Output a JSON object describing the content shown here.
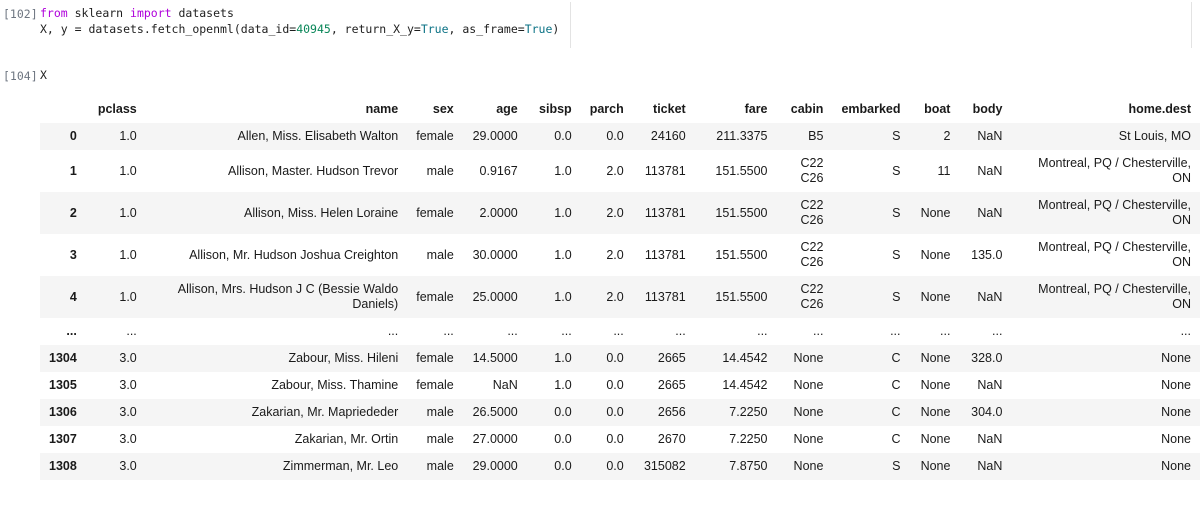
{
  "colors": {
    "keyword": "#af00db",
    "number": "#098658",
    "constant": "#0b7285",
    "code_text": "#1e1e1e",
    "exec_label": "#6e7681",
    "stripe": "#f5f5f5",
    "table_text": "#1a1a1a"
  },
  "notebook": {
    "cells": [
      {
        "type": "code",
        "execution_label": "[102]",
        "code_lines": [
          [
            {
              "t": "kw",
              "v": "from "
            },
            {
              "t": "plain",
              "v": "sklearn "
            },
            {
              "t": "kw",
              "v": "import "
            },
            {
              "t": "plain",
              "v": "datasets"
            }
          ],
          [
            {
              "t": "plain",
              "v": "X, y = datasets.fetch_openml(data_id="
            },
            {
              "t": "num",
              "v": "40945"
            },
            {
              "t": "plain",
              "v": ", return_X_y="
            },
            {
              "t": "const",
              "v": "True"
            },
            {
              "t": "plain",
              "v": ", as_frame="
            },
            {
              "t": "const",
              "v": "True"
            },
            {
              "t": "plain",
              "v": ")"
            }
          ]
        ]
      },
      {
        "type": "code",
        "execution_label": "[104]",
        "code_lines": [
          [
            {
              "t": "plain",
              "v": "X"
            }
          ]
        ],
        "output_table": {
          "columns": [
            "",
            "pclass",
            "name",
            "sex",
            "age",
            "sibsp",
            "parch",
            "ticket",
            "fare",
            "cabin",
            "embarked",
            "boat",
            "body",
            "home.dest"
          ],
          "rows": [
            [
              "0",
              "1.0",
              "Allen, Miss. Elisabeth Walton",
              "female",
              "29.0000",
              "0.0",
              "0.0",
              "24160",
              "211.3375",
              "B5",
              "S",
              "2",
              "NaN",
              "St Louis, MO"
            ],
            [
              "1",
              "1.0",
              "Allison, Master. Hudson Trevor",
              "male",
              "0.9167",
              "1.0",
              "2.0",
              "113781",
              "151.5500",
              "C22 C26",
              "S",
              "11",
              "NaN",
              "Montreal, PQ / Chesterville, ON"
            ],
            [
              "2",
              "1.0",
              "Allison, Miss. Helen Loraine",
              "female",
              "2.0000",
              "1.0",
              "2.0",
              "113781",
              "151.5500",
              "C22 C26",
              "S",
              "None",
              "NaN",
              "Montreal, PQ / Chesterville, ON"
            ],
            [
              "3",
              "1.0",
              "Allison, Mr. Hudson Joshua Creighton",
              "male",
              "30.0000",
              "1.0",
              "2.0",
              "113781",
              "151.5500",
              "C22 C26",
              "S",
              "None",
              "135.0",
              "Montreal, PQ / Chesterville, ON"
            ],
            [
              "4",
              "1.0",
              "Allison, Mrs. Hudson J C (Bessie Waldo Daniels)",
              "female",
              "25.0000",
              "1.0",
              "2.0",
              "113781",
              "151.5500",
              "C22 C26",
              "S",
              "None",
              "NaN",
              "Montreal, PQ / Chesterville, ON"
            ],
            [
              "...",
              "...",
              "...",
              "...",
              "...",
              "...",
              "...",
              "...",
              "...",
              "...",
              "...",
              "...",
              "...",
              "..."
            ],
            [
              "1304",
              "3.0",
              "Zabour, Miss. Hileni",
              "female",
              "14.5000",
              "1.0",
              "0.0",
              "2665",
              "14.4542",
              "None",
              "C",
              "None",
              "328.0",
              "None"
            ],
            [
              "1305",
              "3.0",
              "Zabour, Miss. Thamine",
              "female",
              "NaN",
              "1.0",
              "0.0",
              "2665",
              "14.4542",
              "None",
              "C",
              "None",
              "NaN",
              "None"
            ],
            [
              "1306",
              "3.0",
              "Zakarian, Mr. Mapriededer",
              "male",
              "26.5000",
              "0.0",
              "0.0",
              "2656",
              "7.2250",
              "None",
              "C",
              "None",
              "304.0",
              "None"
            ],
            [
              "1307",
              "3.0",
              "Zakarian, Mr. Ortin",
              "male",
              "27.0000",
              "0.0",
              "0.0",
              "2670",
              "7.2250",
              "None",
              "C",
              "None",
              "NaN",
              "None"
            ],
            [
              "1308",
              "3.0",
              "Zimmerman, Mr. Leo",
              "male",
              "29.0000",
              "0.0",
              "0.0",
              "315082",
              "7.8750",
              "None",
              "S",
              "None",
              "NaN",
              "None"
            ]
          ]
        }
      }
    ]
  }
}
